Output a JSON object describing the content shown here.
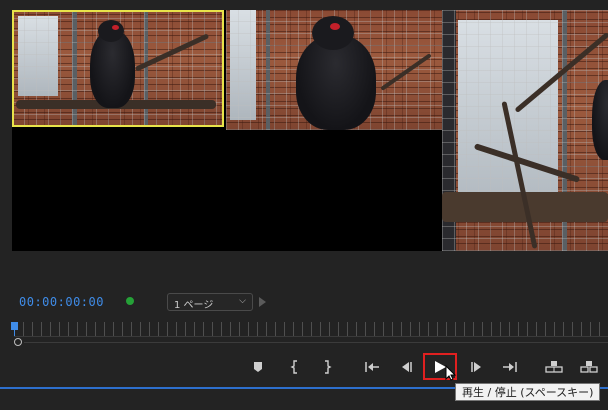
{
  "monitor": {
    "cameras": [
      {
        "name": "camera-angle-1",
        "selected": true
      },
      {
        "name": "camera-angle-2",
        "selected": false
      },
      {
        "name": "camera-angle-3",
        "selected": false
      },
      {
        "name": "camera-angle-4-empty",
        "selected": false
      }
    ],
    "selection_color": "#e8e34a"
  },
  "transport": {
    "timecode": "00:00:00:00",
    "timecode_color": "#3f8ce8",
    "status_color": "#25a137",
    "page_select": {
      "value": "1 ページ"
    },
    "buttons": [
      {
        "name": "add-marker-button",
        "icon": "marker-icon"
      },
      {
        "name": "mark-in-button",
        "icon": "mark-in-icon"
      },
      {
        "name": "mark-out-button",
        "icon": "mark-out-icon"
      },
      {
        "name": "go-to-in-button",
        "icon": "go-to-in-icon"
      },
      {
        "name": "step-back-button",
        "icon": "step-back-icon"
      },
      {
        "name": "play-stop-button",
        "icon": "play-icon"
      },
      {
        "name": "step-forward-button",
        "icon": "step-forward-icon"
      },
      {
        "name": "go-to-out-button",
        "icon": "go-to-out-icon"
      },
      {
        "name": "lift-button",
        "icon": "lift-icon"
      },
      {
        "name": "extract-button",
        "icon": "extract-icon"
      }
    ]
  },
  "tooltip": {
    "text": "再生 / 停止 (スペースキー)"
  },
  "colors": {
    "background": "#232323",
    "highlight": "#e02020",
    "accent_blue": "#2d6fcc"
  }
}
